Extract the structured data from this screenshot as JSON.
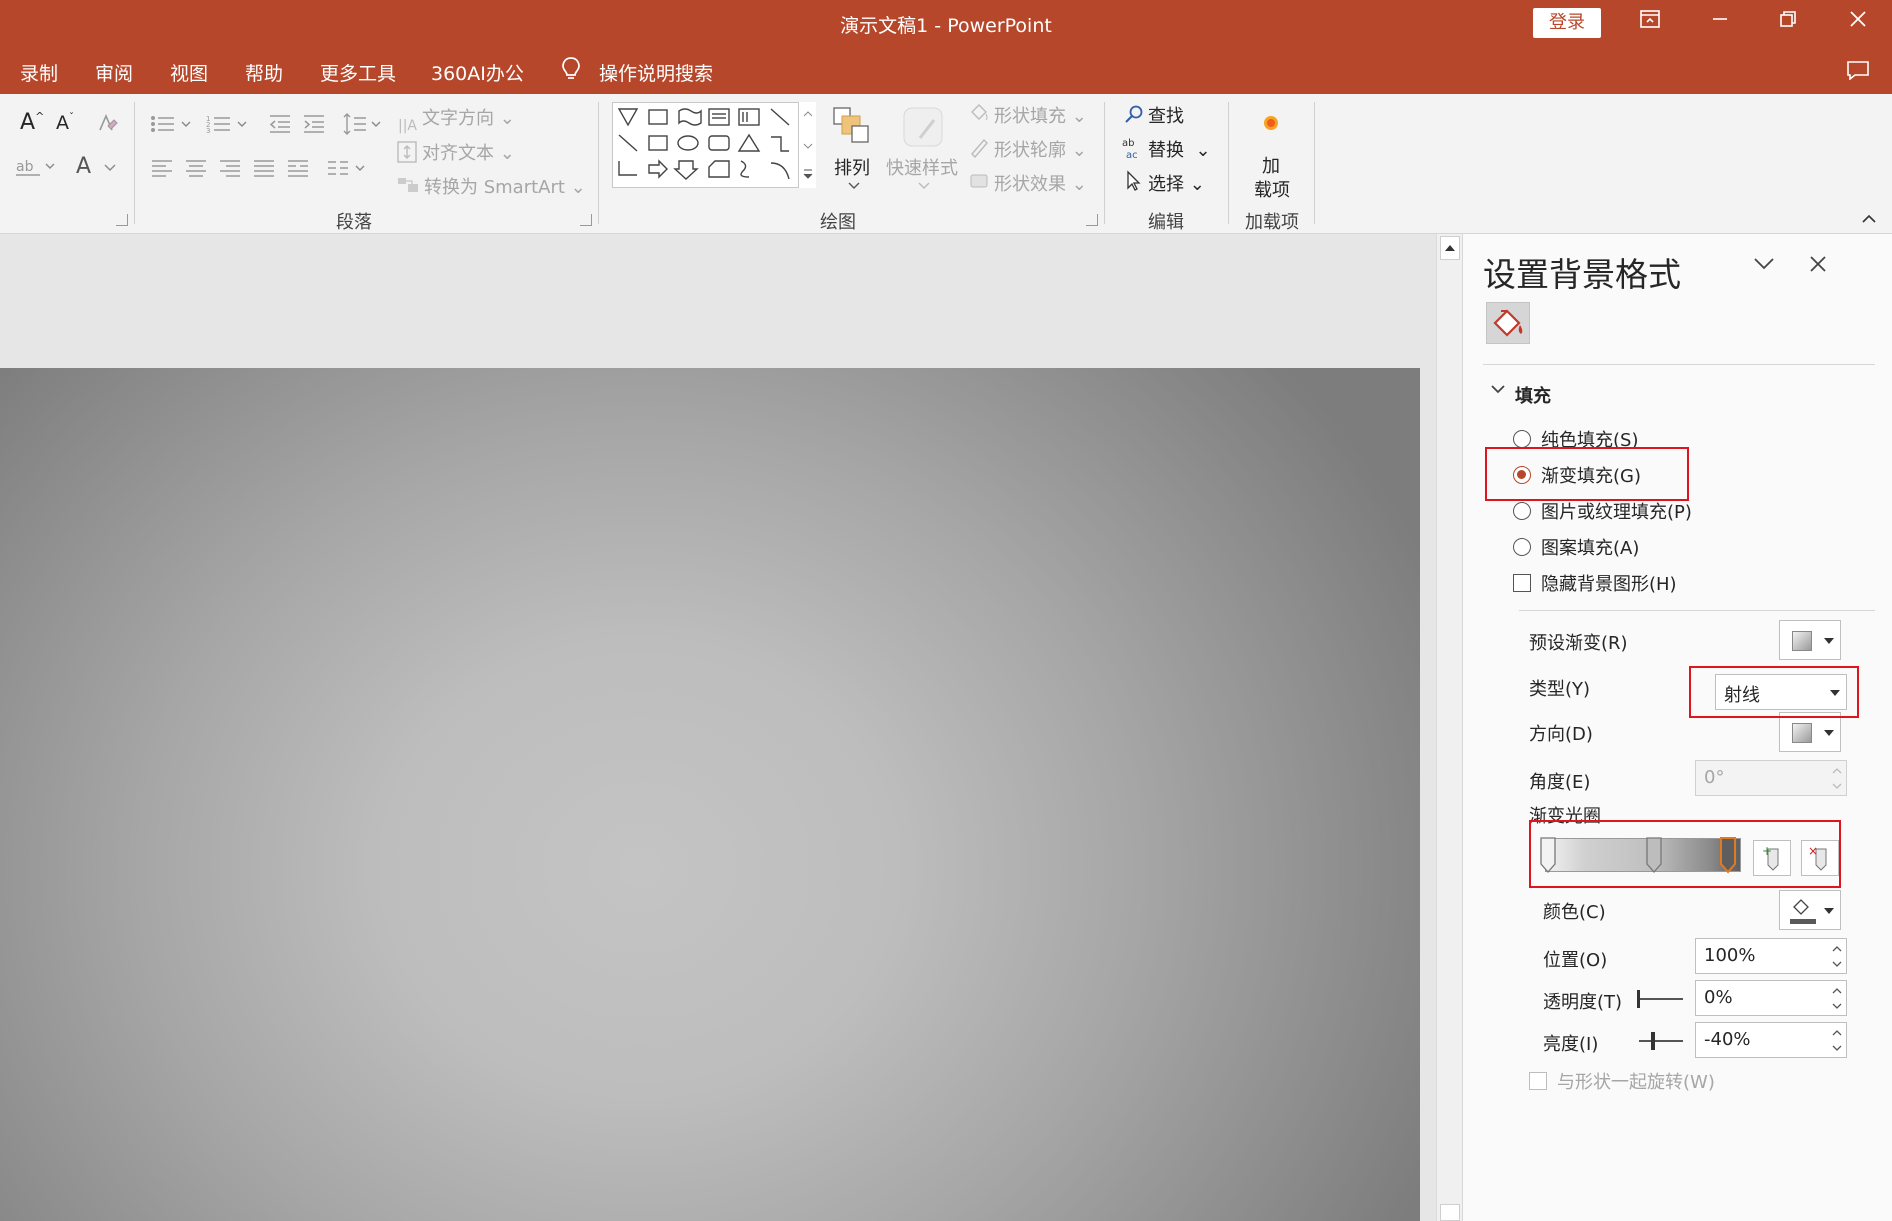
{
  "window": {
    "title": "演示文稿1  -  PowerPoint",
    "login_label": "登录",
    "colors": {
      "accent": "#b7472a",
      "highlight_box": "#e0141e"
    }
  },
  "menu": {
    "items": [
      "录制",
      "审阅",
      "视图",
      "帮助",
      "更多工具",
      "360AI办公"
    ],
    "search_label": "操作说明搜索"
  },
  "ribbon": {
    "paragraph": {
      "group_label": "段落",
      "text_direction": "文字方向",
      "align_text": "对齐文本",
      "convert_smartart": "转换为 SmartArt"
    },
    "drawing": {
      "group_label": "绘图",
      "arrange": "排列",
      "quick_styles": "快速样式",
      "shape_fill": "形状填充",
      "shape_outline": "形状轮廓",
      "shape_effects": "形状效果"
    },
    "editing": {
      "group_label": "编辑",
      "find": "查找",
      "replace": "替换",
      "select": "选择"
    },
    "addins": {
      "group_label": "加载项",
      "button_line1": "加",
      "button_line2": "载项"
    }
  },
  "format_pane": {
    "title": "设置背景格式",
    "section": "填充",
    "options": {
      "solid": "纯色填充(S)",
      "gradient": "渐变填充(G)",
      "picture": "图片或纹理填充(P)",
      "pattern": "图案填充(A)",
      "hide_bg": "隐藏背景图形(H)"
    },
    "selected_option": "gradient",
    "preset_label": "预设渐变(R)",
    "type_label": "类型(Y)",
    "type_value": "射线",
    "direction_label": "方向(D)",
    "angle_label": "角度(E)",
    "angle_value": "0°",
    "stops_label": "渐变光圈",
    "color_label": "颜色(C)",
    "position_label": "位置(O)",
    "position_value": "100%",
    "transparency_label": "透明度(T)",
    "transparency_value": "0%",
    "brightness_label": "亮度(I)",
    "brightness_value": "-40%",
    "rotate_label": "与形状一起旋转(W)"
  }
}
